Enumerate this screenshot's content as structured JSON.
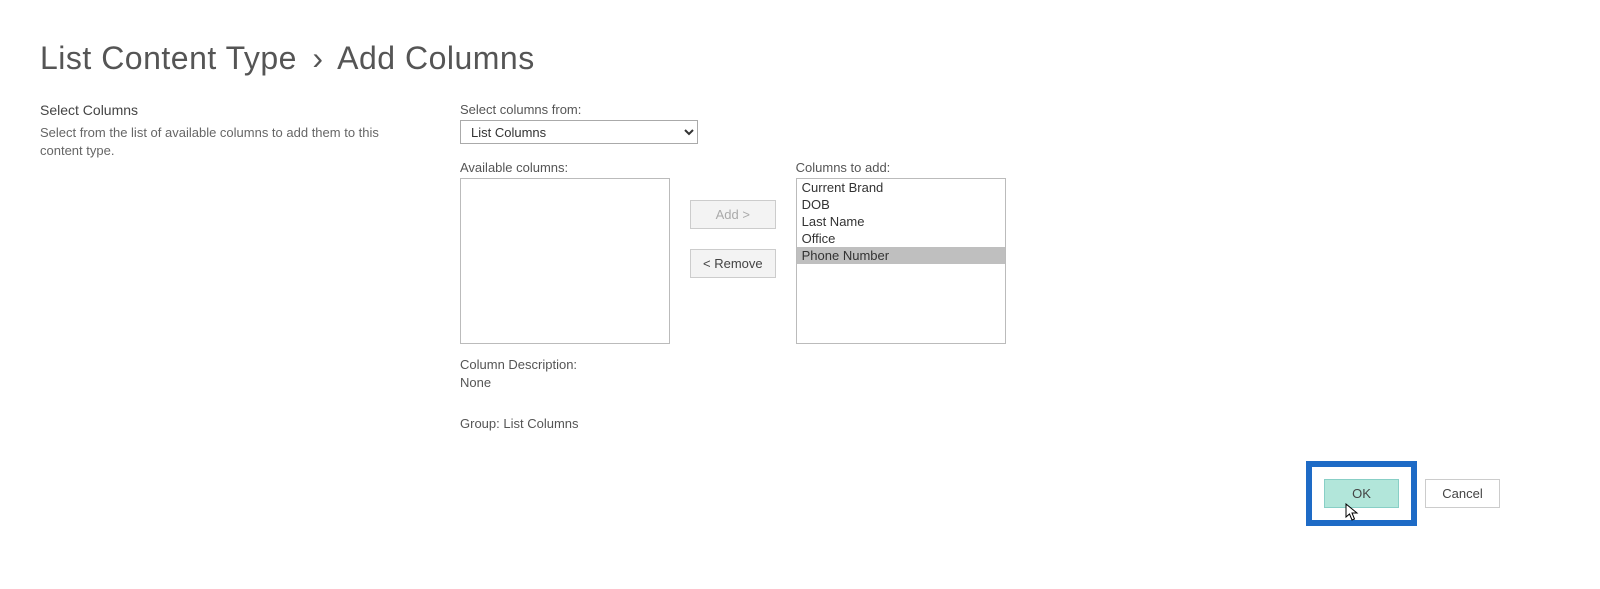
{
  "breadcrumb": {
    "parent": "List Content Type",
    "separator": "›",
    "current": "Add Columns"
  },
  "left": {
    "heading": "Select Columns",
    "description": "Select from the list of available columns to add them to this content type."
  },
  "main": {
    "select_from_label": "Select columns from:",
    "select_from_value": "List Columns",
    "available_label": "Available columns:",
    "available_items": [],
    "to_add_label": "Columns to add:",
    "to_add_items": [
      {
        "label": "Current Brand",
        "selected": false
      },
      {
        "label": "DOB",
        "selected": false
      },
      {
        "label": "Last Name",
        "selected": false
      },
      {
        "label": "Office",
        "selected": false
      },
      {
        "label": "Phone Number",
        "selected": true
      }
    ],
    "add_button": "Add >",
    "remove_button": "< Remove",
    "desc_label": "Column Description:",
    "desc_value": "None",
    "group_prefix": "Group: ",
    "group_value": "List Columns"
  },
  "footer": {
    "ok": "OK",
    "cancel": "Cancel"
  }
}
